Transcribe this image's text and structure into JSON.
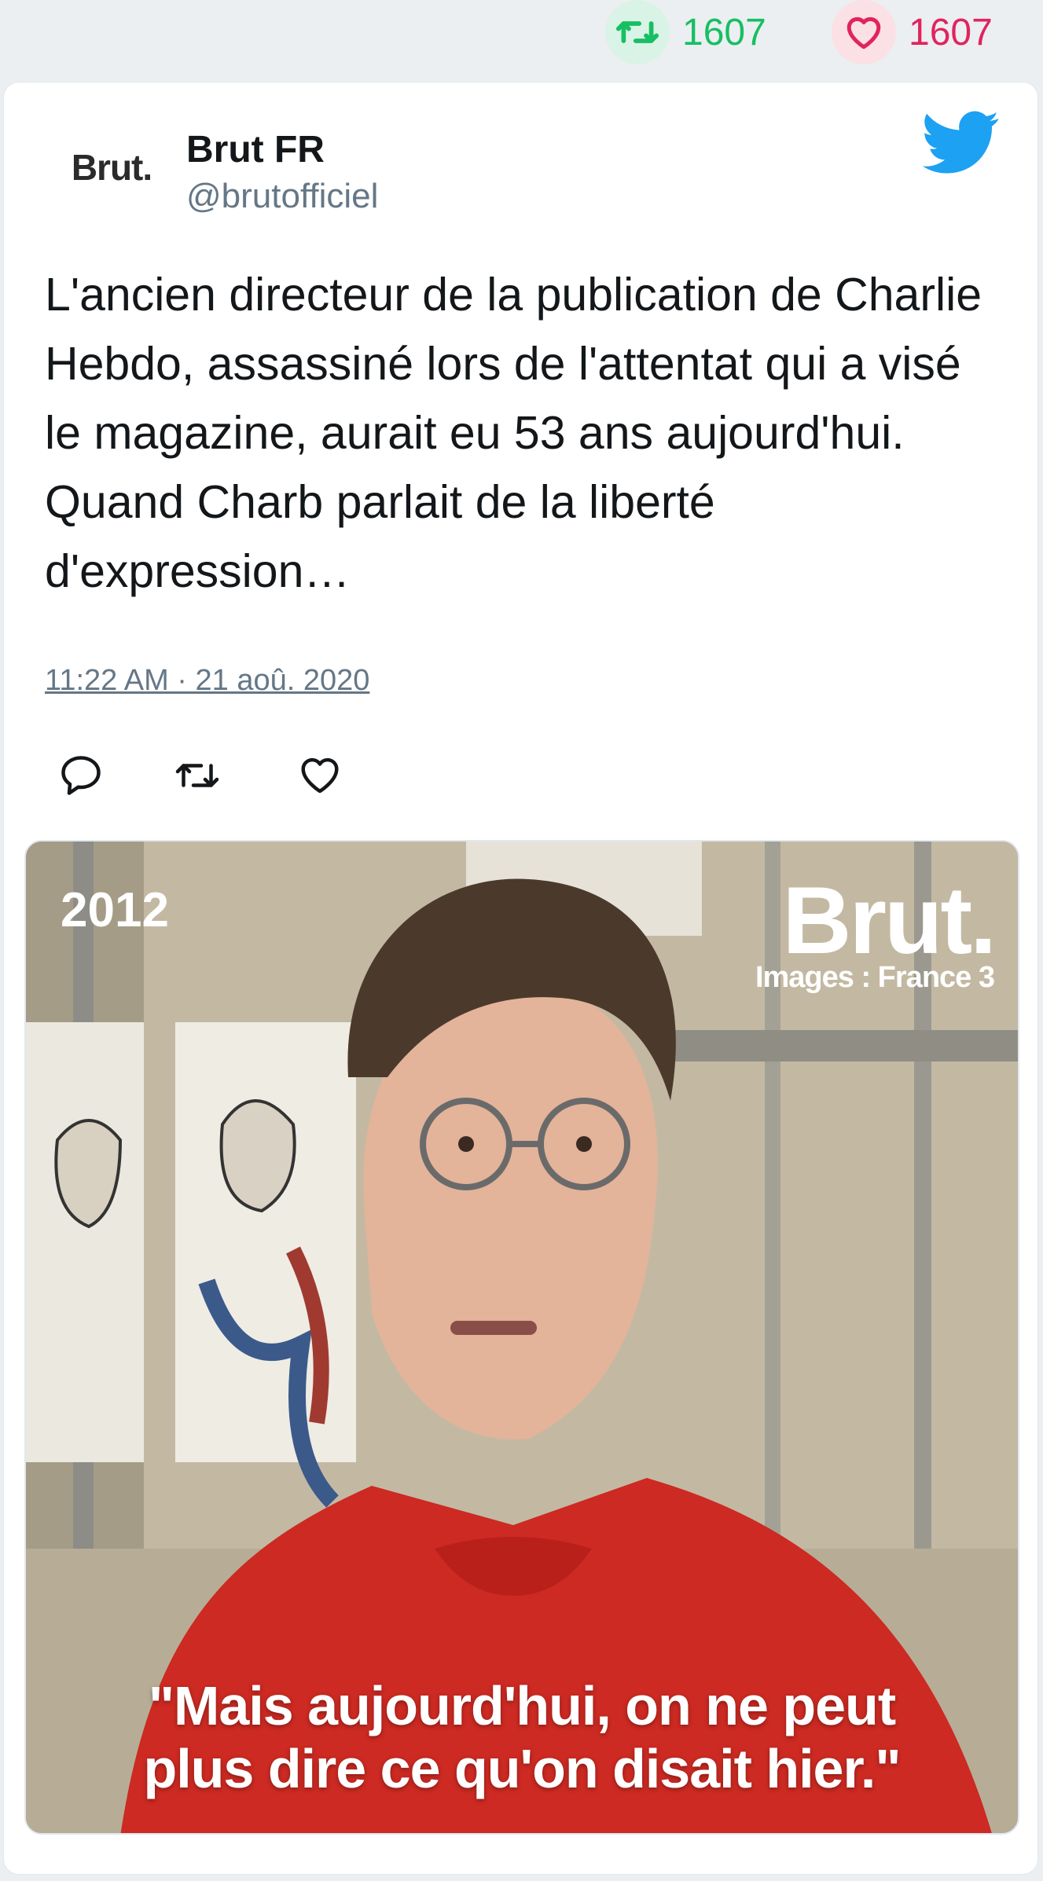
{
  "stats": {
    "retweet_count": "1607",
    "like_count": "1607"
  },
  "tweet": {
    "avatar_logo": "Brut.",
    "author_name": "Brut FR",
    "author_handle": "@brutofficiel",
    "text": "L'ancien directeur de la publication de Charlie Hebdo, assassiné lors de l'attentat qui a visé le magazine, aurait eu 53 ans aujourd'hui. Quand Charb parlait de la liberté d'expression…",
    "timestamp": "11:22 AM · 21 aoû. 2020"
  },
  "media": {
    "year_label": "2012",
    "brand_logo": "Brut.",
    "credit": "Images : France 3",
    "caption_line1": "\"Mais aujourd'hui, on ne peut",
    "caption_line2": "plus dire ce qu'on disait hier.\""
  },
  "colors": {
    "retweet_green": "#17bf63",
    "like_red": "#e0245e",
    "twitter_blue": "#1da1f2"
  },
  "icons": [
    "retweet-icon",
    "heart-icon",
    "twitter-bird-icon",
    "reply-icon"
  ]
}
